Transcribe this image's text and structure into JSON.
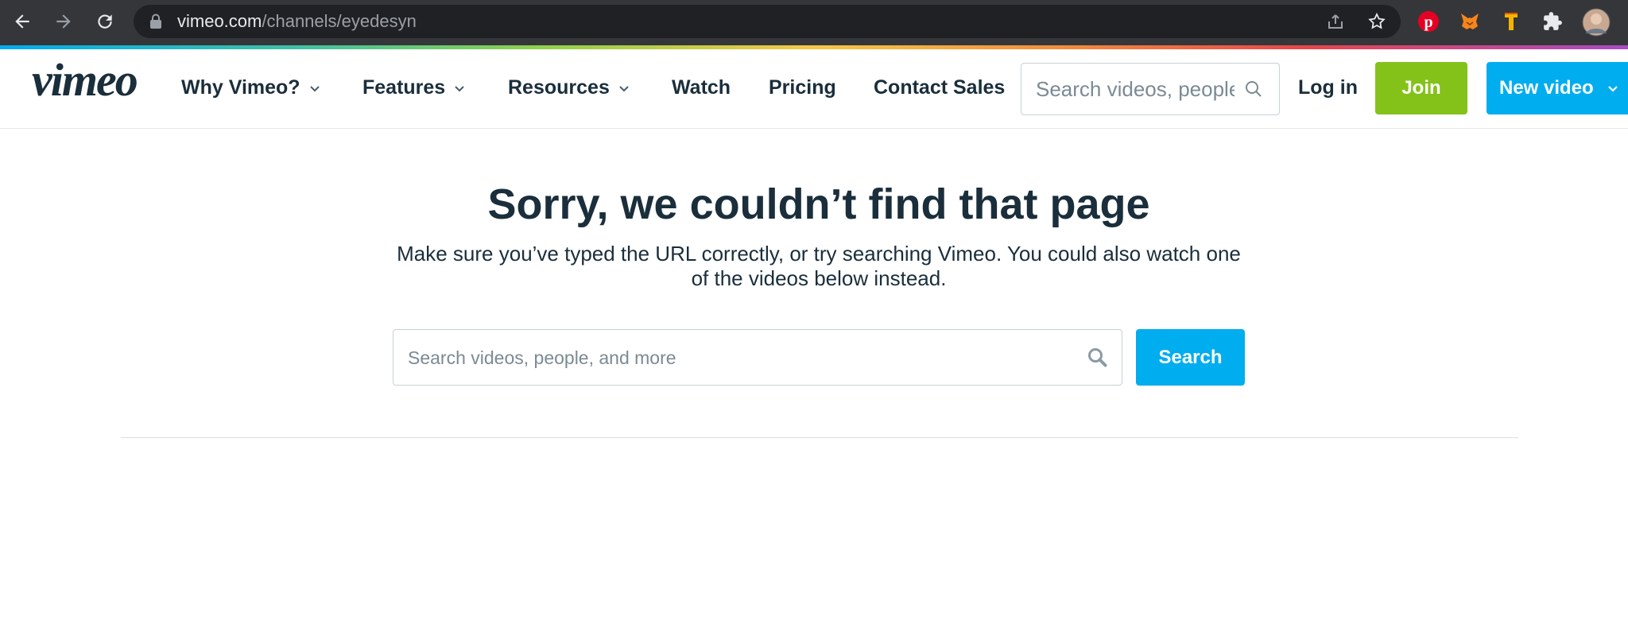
{
  "browser": {
    "url_host": "vimeo.com",
    "url_path": "/channels/eyedesyn",
    "icons": [
      "back-icon",
      "forward-icon",
      "reload-icon",
      "lock-icon",
      "share-icon",
      "bookmark-star-icon",
      "pinterest-icon",
      "metamask-icon",
      "extension-tool-icon",
      "puzzle-icon",
      "profile-avatar"
    ]
  },
  "header": {
    "logo": "vimeo",
    "nav": [
      {
        "label": "Why Vimeo?",
        "dropdown": true
      },
      {
        "label": "Features",
        "dropdown": true
      },
      {
        "label": "Resources",
        "dropdown": true
      },
      {
        "label": "Watch",
        "dropdown": false
      },
      {
        "label": "Pricing",
        "dropdown": false
      },
      {
        "label": "Contact Sales",
        "dropdown": false
      }
    ],
    "search_placeholder": "Search videos, people, and more",
    "login_label": "Log in",
    "join_label": "Join",
    "new_video_label": "New video"
  },
  "main": {
    "title": "Sorry, we couldn’t find that page",
    "subtitle": "Make sure you’ve typed the URL correctly, or try searching Vimeo. You could also watch one of the videos below instead.",
    "search_placeholder": "Search videos, people, and more",
    "search_button": "Search"
  },
  "colors": {
    "brand_blue": "#00adef",
    "join_green": "#84c21a",
    "text_dark": "#1a2e3b"
  }
}
